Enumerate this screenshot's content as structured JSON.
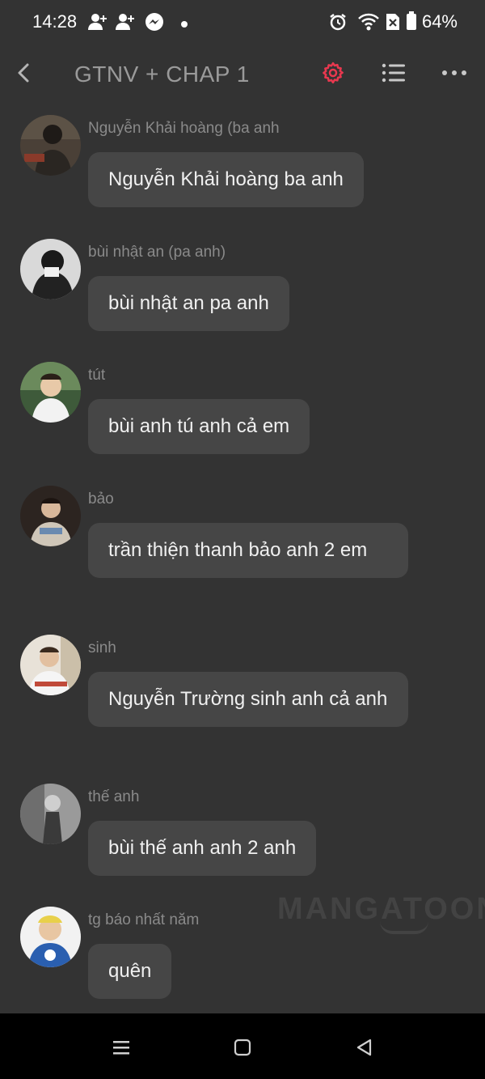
{
  "status_bar": {
    "time": "14:28",
    "battery_percent": "64%",
    "icons": [
      "person-add-icon",
      "person-add-icon",
      "messenger-icon",
      "dot-icon",
      "alarm-icon",
      "wifi-icon",
      "no-sim-icon",
      "battery-icon"
    ]
  },
  "header": {
    "title": "GTNV + CHAP 1",
    "back_icon": "chevron-left-icon",
    "settings_icon": "gear-icon",
    "list_icon": "list-icon",
    "more_icon": "more-horizontal-icon",
    "accent_color": "#e8384f"
  },
  "messages": [
    {
      "sender": "Nguyễn Khải hoàng (ba anh",
      "text": "Nguyễn Khải hoàng ba anh"
    },
    {
      "sender": "bùi nhật an (pa anh)",
      "text": "bùi nhật an pa anh"
    },
    {
      "sender": "tút",
      "text": "bùi anh tú anh cả em"
    },
    {
      "sender": "bảo",
      "text": "trần thiện thanh bảo anh 2 em"
    },
    {
      "sender": "sinh",
      "text": "Nguyễn Trường sinh anh cả anh"
    },
    {
      "sender": "thế anh",
      "text": "bùi thế anh anh 2 anh"
    },
    {
      "sender": "tg báo nhất năm",
      "text": "quên"
    }
  ],
  "watermark": "MANGATOON",
  "nav_bar": {
    "icons": [
      "recent-apps-icon",
      "home-icon",
      "back-icon"
    ]
  }
}
